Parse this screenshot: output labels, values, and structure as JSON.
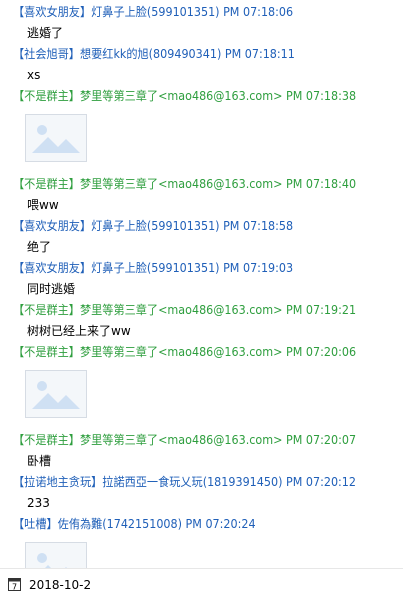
{
  "messages": [
    {
      "header": "【喜欢女朋友】灯鼻子上脸(599101351) PM 07:18:06",
      "color": "#1f5fb8",
      "body": "逃婚了"
    },
    {
      "header": "【社会旭哥】想要红kk的旭(809490341) PM 07:18:11",
      "color": "#1f5fb8",
      "body": "xs"
    },
    {
      "header": "【不是群主】梦里等第三章了<mao486@163.com> PM 07:18:38",
      "color": "#2e9e3e",
      "body": ""
    },
    {
      "header": "【不是群主】梦里等第三章了<mao486@163.com> PM 07:18:40",
      "color": "#2e9e3e",
      "body": "喂ww"
    },
    {
      "header": "【喜欢女朋友】灯鼻子上脸(599101351) PM 07:18:58",
      "color": "#1f5fb8",
      "body": "绝了"
    },
    {
      "header": "【喜欢女朋友】灯鼻子上脸(599101351) PM 07:19:03",
      "color": "#1f5fb8",
      "body": "同时逃婚"
    },
    {
      "header": "【不是群主】梦里等第三章了<mao486@163.com> PM 07:19:21",
      "color": "#2e9e3e",
      "body": "树树已经上来了ww"
    },
    {
      "header": "【不是群主】梦里等第三章了<mao486@163.com> PM 07:20:06",
      "color": "#2e9e3e",
      "body": ""
    },
    {
      "header": "【不是群主】梦里等第三章了<mao486@163.com> PM 07:20:07",
      "color": "#2e9e3e",
      "body": "卧槽"
    },
    {
      "header": "【拉诺地主贪玩】拉諾西亞一食玩乂玩(1819391450) PM 07:20:12",
      "color": "#1f5fb8",
      "body": "233"
    },
    {
      "header": "【吐槽】佐侑為難(1742151008) PM 07:20:24",
      "color": "#1f5fb8",
      "body": ""
    }
  ],
  "status": {
    "calendar_icon": "calendar-icon",
    "calendar_day": "7",
    "date": "2018-10-2"
  },
  "colors": {
    "sender_blue": "#1f5fb8",
    "sender_green": "#2e9e3e",
    "image_placeholder_fill": "#f4f7fa",
    "image_placeholder_art": "#cfe0f3"
  }
}
